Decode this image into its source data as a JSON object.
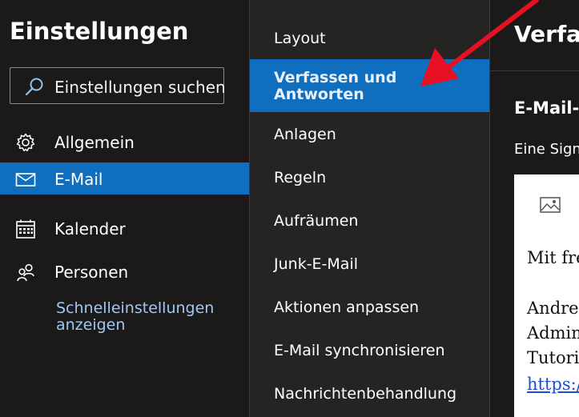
{
  "sidebar": {
    "title": "Einstellungen",
    "search_label": "Einstellungen suchen",
    "items": [
      {
        "label": "Allgemein",
        "icon": "gear-icon"
      },
      {
        "label": "E-Mail",
        "icon": "mail-icon",
        "selected": true
      },
      {
        "label": "Kalender",
        "icon": "calendar-icon"
      },
      {
        "label": "Personen",
        "icon": "people-icon"
      }
    ],
    "quick_settings_link": "Schnelleinstellungen anzeigen"
  },
  "submenu": {
    "items": [
      {
        "label": "Layout"
      },
      {
        "label": "Verfassen und Antworten",
        "selected": true
      },
      {
        "label": "Anlagen"
      },
      {
        "label": "Regeln"
      },
      {
        "label": "Aufräumen"
      },
      {
        "label": "Junk-E-Mail"
      },
      {
        "label": "Aktionen anpassen"
      },
      {
        "label": "E-Mail synchronisieren"
      },
      {
        "label": "Nachrichtenbehandlung"
      }
    ]
  },
  "panel": {
    "title": "Verfas",
    "section_title": "E-Mail-",
    "section_desc": "Eine Sign",
    "signature_lines": [
      "Mit fre",
      "Andre",
      "Admin",
      "Tutori",
      "https:/"
    ]
  },
  "colors": {
    "accent": "#106ebe",
    "link": "#9fc7f5",
    "annotation_arrow": "#e81123"
  }
}
